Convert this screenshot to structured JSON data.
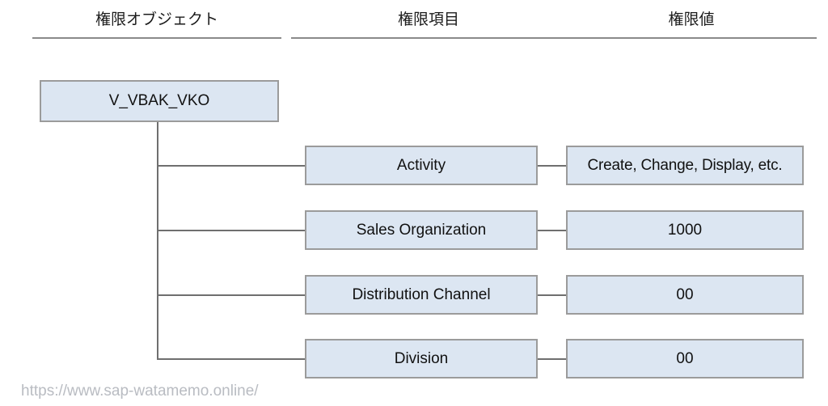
{
  "diagram": {
    "columns": [
      {
        "label": "権限オブジェクト"
      },
      {
        "label": "権限項目"
      },
      {
        "label": "権限値"
      }
    ],
    "root": {
      "label": "V_VBAK_VKO"
    },
    "rows": [
      {
        "field": "Activity",
        "value": "Create, Change, Display, etc."
      },
      {
        "field": "Sales Organization",
        "value": "1000"
      },
      {
        "field": "Distribution Channel",
        "value": "00"
      },
      {
        "field": "Division",
        "value": "00"
      }
    ],
    "watermark": "https://www.sap-watamemo.online/",
    "colors": {
      "box_fill": "#dce6f2",
      "box_border": "#9b9b9b",
      "connector": "#6f6f6f",
      "rule": "#8a8a8a",
      "text": "#111111",
      "watermark": "#b9bcc2"
    }
  }
}
